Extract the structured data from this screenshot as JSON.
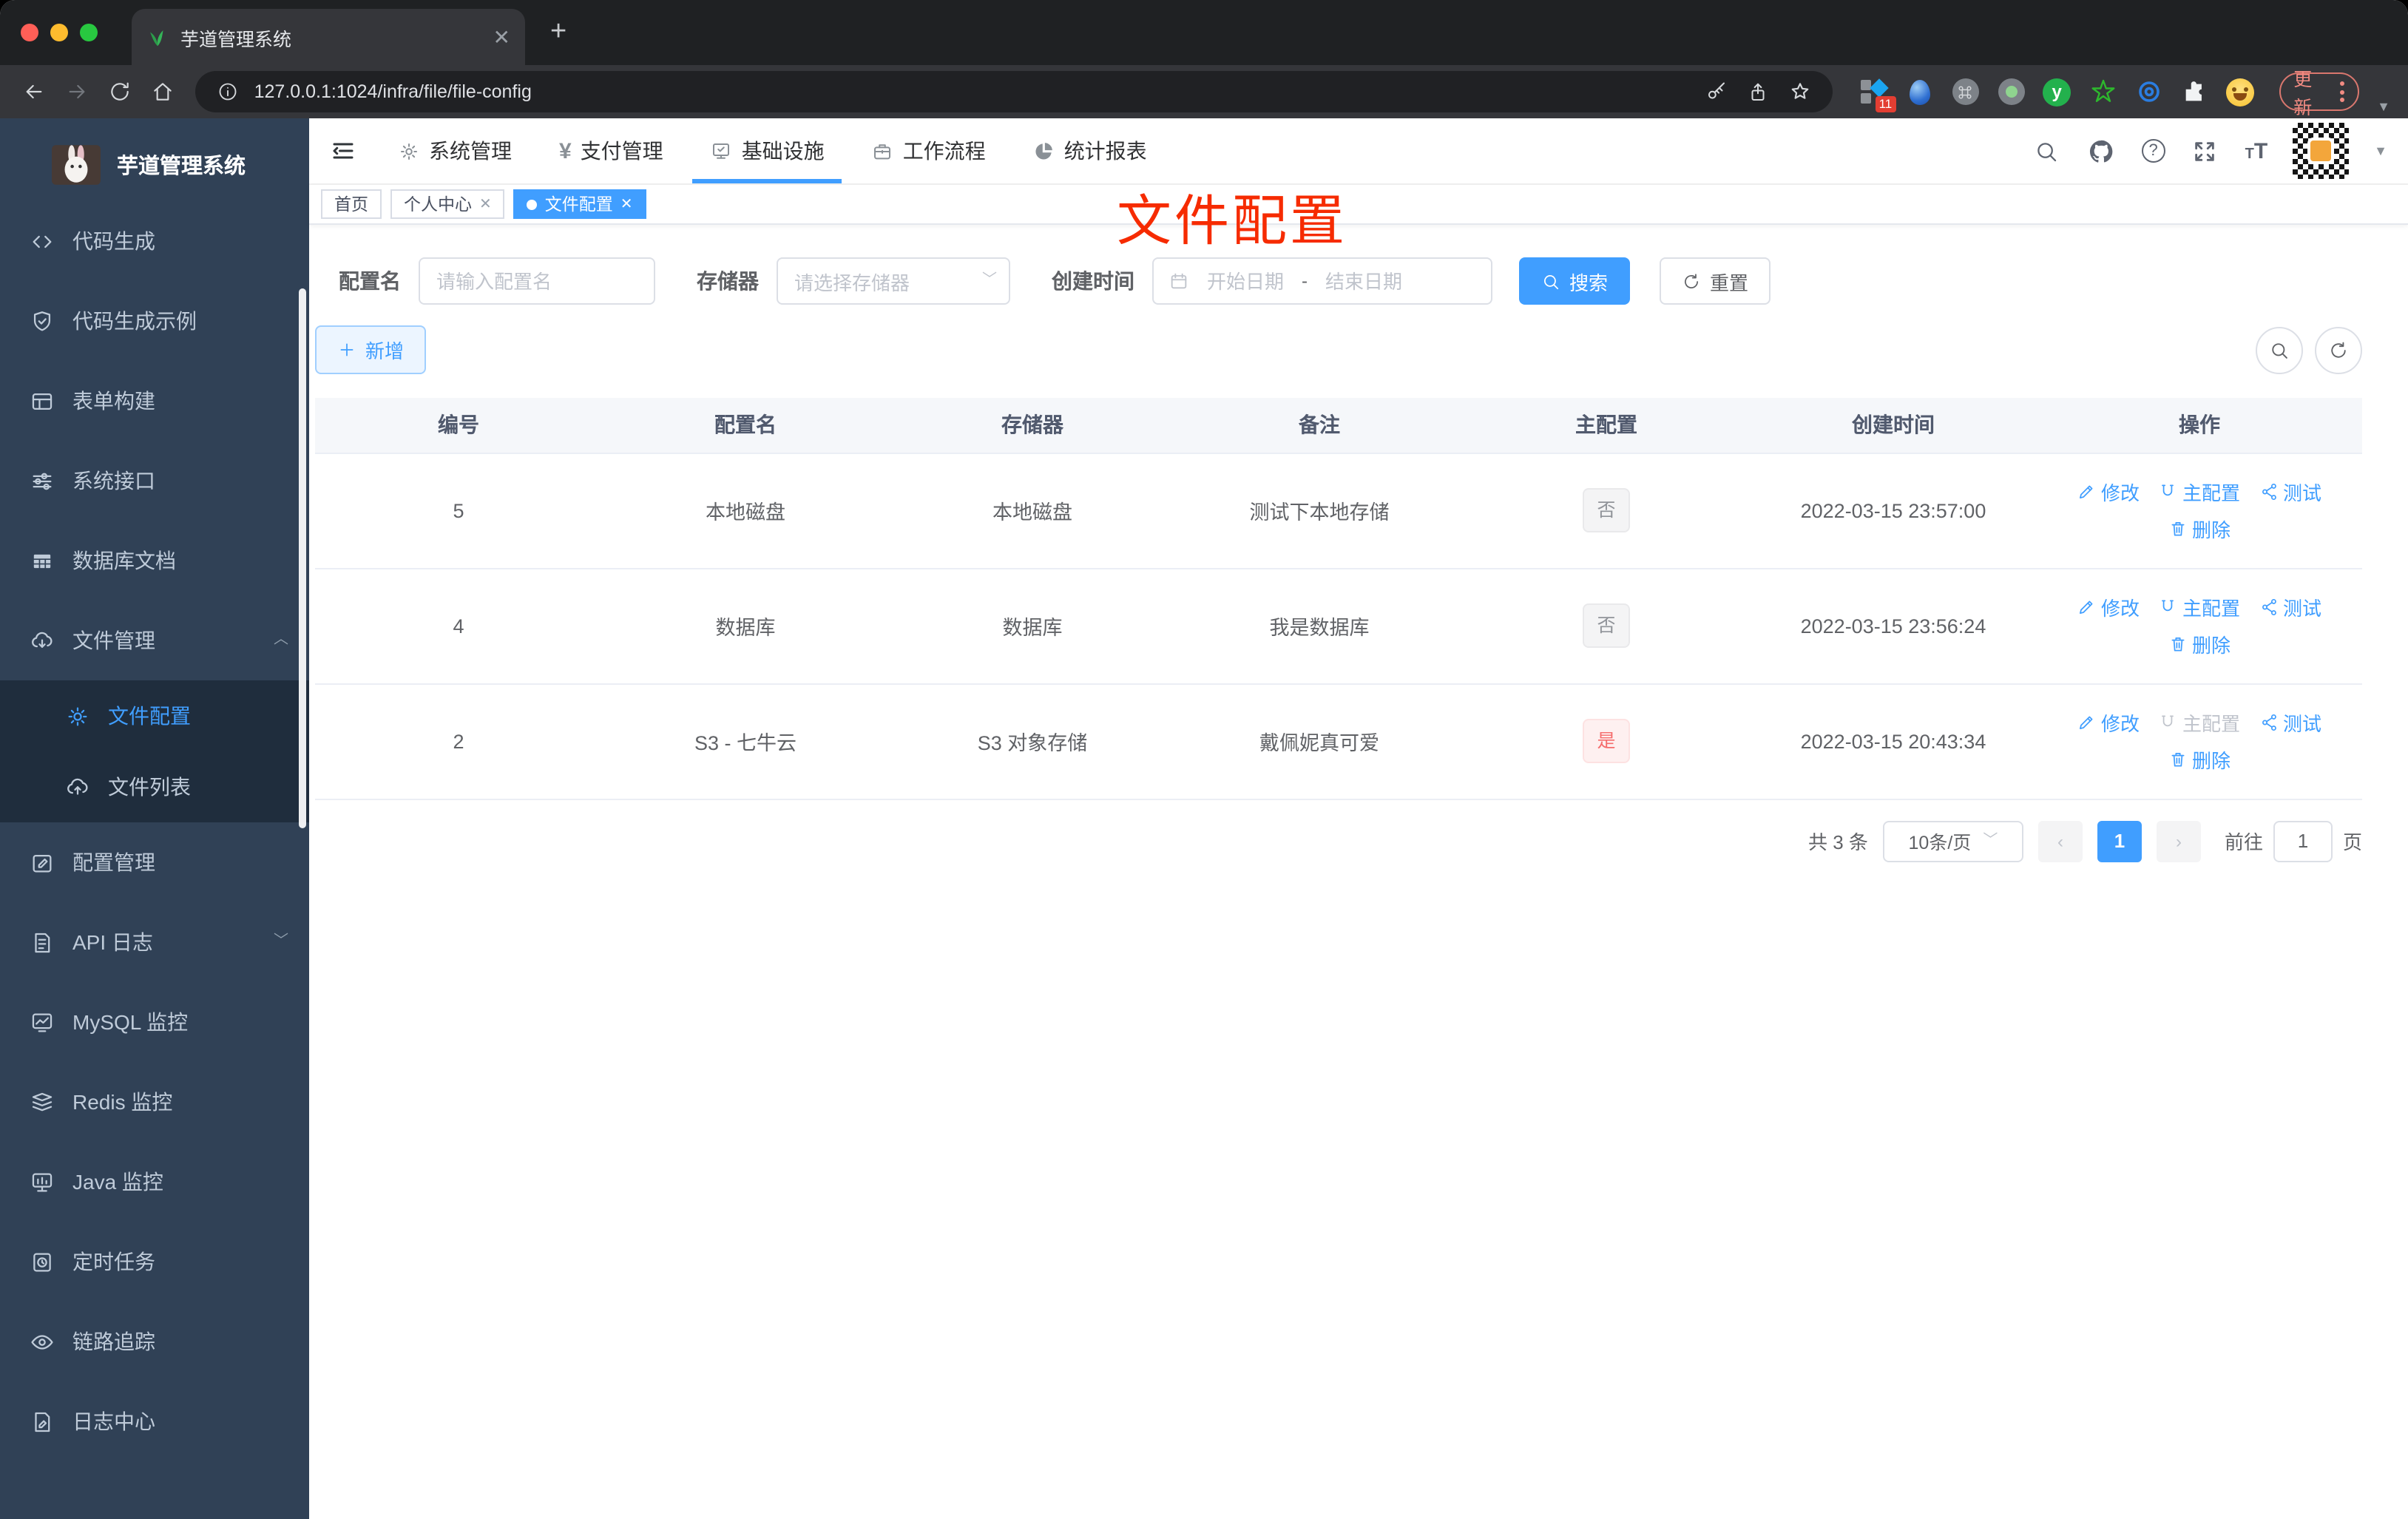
{
  "browser": {
    "tab_title": "芋道管理系统",
    "url": "127.0.0.1:1024/infra/file/file-config",
    "extension_badge": "11",
    "update_label": "更新"
  },
  "sidebar": {
    "title": "芋道管理系统",
    "items": [
      {
        "label": "代码生成",
        "icon": "code-icon"
      },
      {
        "label": "代码生成示例",
        "icon": "shield-check-icon"
      },
      {
        "label": "表单构建",
        "icon": "form-icon"
      },
      {
        "label": "系统接口",
        "icon": "sliders-icon"
      },
      {
        "label": "数据库文档",
        "icon": "table-icon"
      },
      {
        "label": "文件管理",
        "icon": "cloud-download-icon"
      }
    ],
    "submenu": [
      {
        "label": "文件配置",
        "icon": "gear-icon",
        "active": true
      },
      {
        "label": "文件列表",
        "icon": "cloud-upload-icon"
      }
    ],
    "items_after": [
      {
        "label": "配置管理",
        "icon": "edit-square-icon"
      },
      {
        "label": "API 日志",
        "icon": "doc-edit-icon"
      },
      {
        "label": "MySQL 监控",
        "icon": "chart-monitor-icon"
      },
      {
        "label": "Redis 监控",
        "icon": "layers-icon"
      },
      {
        "label": "Java 监控",
        "icon": "screen-icon"
      },
      {
        "label": "定时任务",
        "icon": "schedule-icon"
      },
      {
        "label": "链路追踪",
        "icon": "eye-icon"
      },
      {
        "label": "日志中心",
        "icon": "log-icon"
      }
    ]
  },
  "header": {
    "menus": [
      "系统管理",
      "支付管理",
      "基础设施",
      "工作流程",
      "统计报表"
    ],
    "active": "基础设施"
  },
  "tags": {
    "items": [
      "首页",
      "个人中心",
      "文件配置"
    ]
  },
  "annotation": {
    "text": "文件配置",
    "color": "#f62b00"
  },
  "filter": {
    "name_label": "配置名",
    "name_placeholder": "请输入配置名",
    "storage_label": "存储器",
    "storage_placeholder": "请选择存储器",
    "time_label": "创建时间",
    "start_placeholder": "开始日期",
    "separator": "-",
    "end_placeholder": "结束日期",
    "search_label": "搜索",
    "reset_label": "重置"
  },
  "toolbar": {
    "add_label": "新增"
  },
  "table": {
    "headers": [
      "编号",
      "配置名",
      "存储器",
      "备注",
      "主配置",
      "创建时间",
      "操作"
    ],
    "actions": {
      "edit": "修改",
      "master": "主配置",
      "test": "测试",
      "remove": "删除"
    },
    "rows": [
      {
        "id": "5",
        "name": "本地磁盘",
        "storage": "本地磁盘",
        "remark": "测试下本地存储",
        "master": "否",
        "time": "2022-03-15 23:57:00"
      },
      {
        "id": "4",
        "name": "数据库",
        "storage": "数据库",
        "remark": "我是数据库",
        "master": "否",
        "time": "2022-03-15 23:56:24"
      },
      {
        "id": "2",
        "name": "S3 - 七牛云",
        "storage": "S3 对象存储",
        "remark": "戴佩妮真可爱",
        "master": "是",
        "time": "2022-03-15 20:43:34"
      }
    ]
  },
  "pagination": {
    "total": "共 3 条",
    "page_size": "10条/页",
    "current_page": "1",
    "goto_label": "前往",
    "goto_value": "1",
    "page_unit": "页"
  },
  "colors": {
    "accent": "#409eff",
    "danger": "#f56c6c",
    "sidebar_bg": "#304156",
    "submenu_bg": "#1f2d3d",
    "annotation": "#f62b00"
  }
}
